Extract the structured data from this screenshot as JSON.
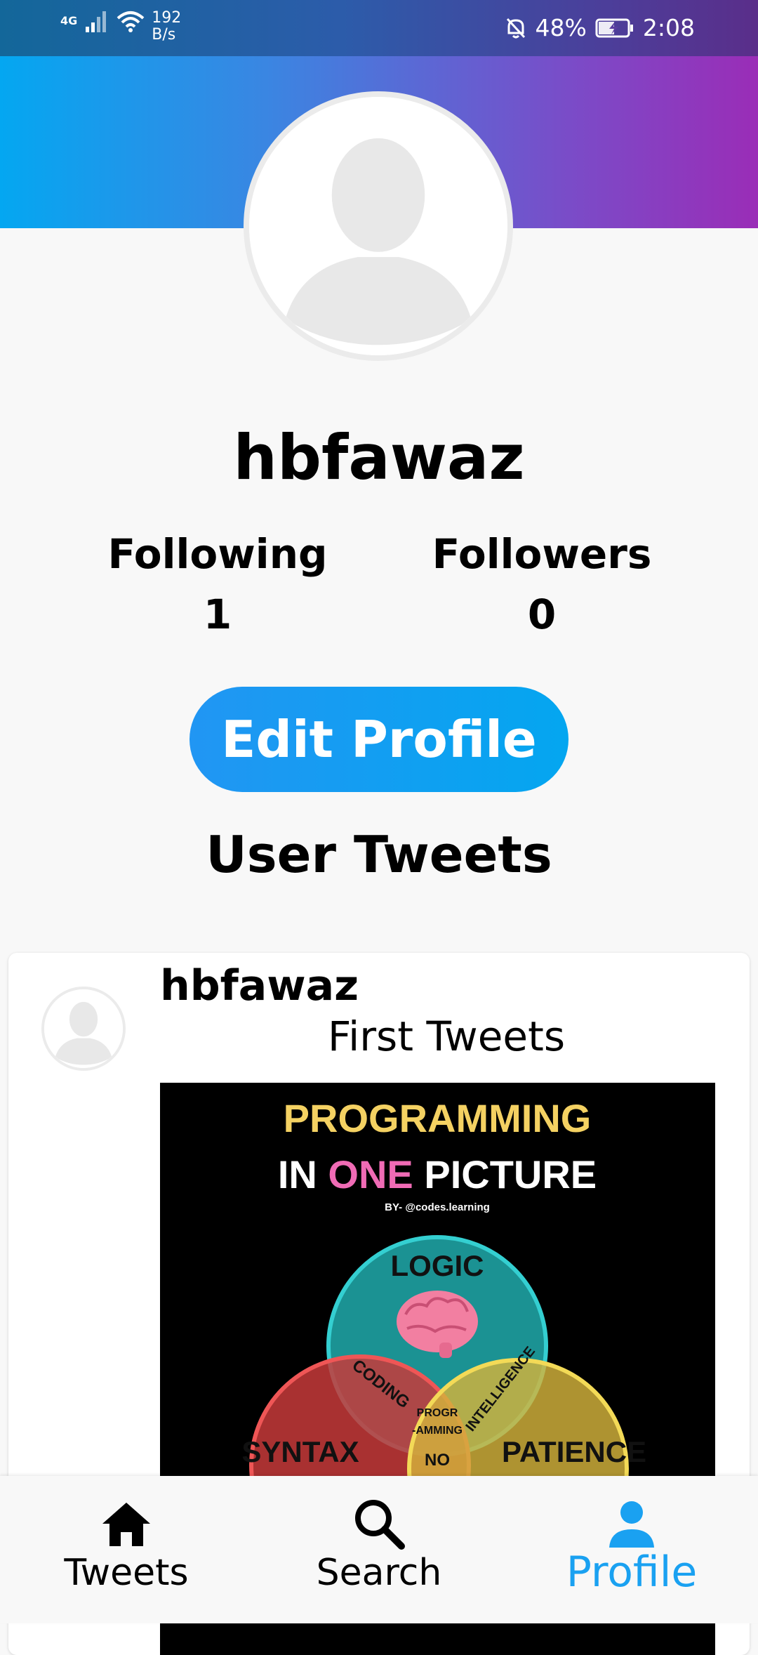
{
  "status_bar": {
    "network": "4G",
    "speed_value": "192",
    "speed_unit": "B/s",
    "battery": "48%",
    "time": "2:08"
  },
  "profile": {
    "username": "hbfawaz",
    "following_label": "Following",
    "following_count": "1",
    "followers_label": "Followers",
    "followers_count": "0",
    "edit_button_label": "Edit Profile"
  },
  "tweets_section": {
    "title": "User Tweets"
  },
  "tweets": [
    {
      "username": "hbfawaz",
      "text": "First Tweets",
      "image": {
        "title_line1": "PROGRAMMING",
        "title_line2_a": "IN ",
        "title_line2_b": "ONE",
        "title_line2_c": " PICTURE",
        "byline": "BY- @codes.learning",
        "circle_top": "LOGIC",
        "circle_left": "SYNTAX",
        "circle_right": "PATIENCE",
        "overlap_left": "CODING",
        "overlap_right": "INTELLIGENCE",
        "center_line1": "PROGR",
        "center_line2": "-AMMING",
        "bottom_overlap": "NO"
      }
    }
  ],
  "bottom_nav": {
    "items": [
      {
        "label": "Tweets",
        "icon": "home-icon"
      },
      {
        "label": "Search",
        "icon": "search-icon"
      },
      {
        "label": "Profile",
        "icon": "person-icon"
      }
    ],
    "active": "Profile"
  },
  "colors": {
    "accent": "#1aa1f1",
    "banner_start": "#04a7f1",
    "banner_end": "#9a2db7"
  }
}
